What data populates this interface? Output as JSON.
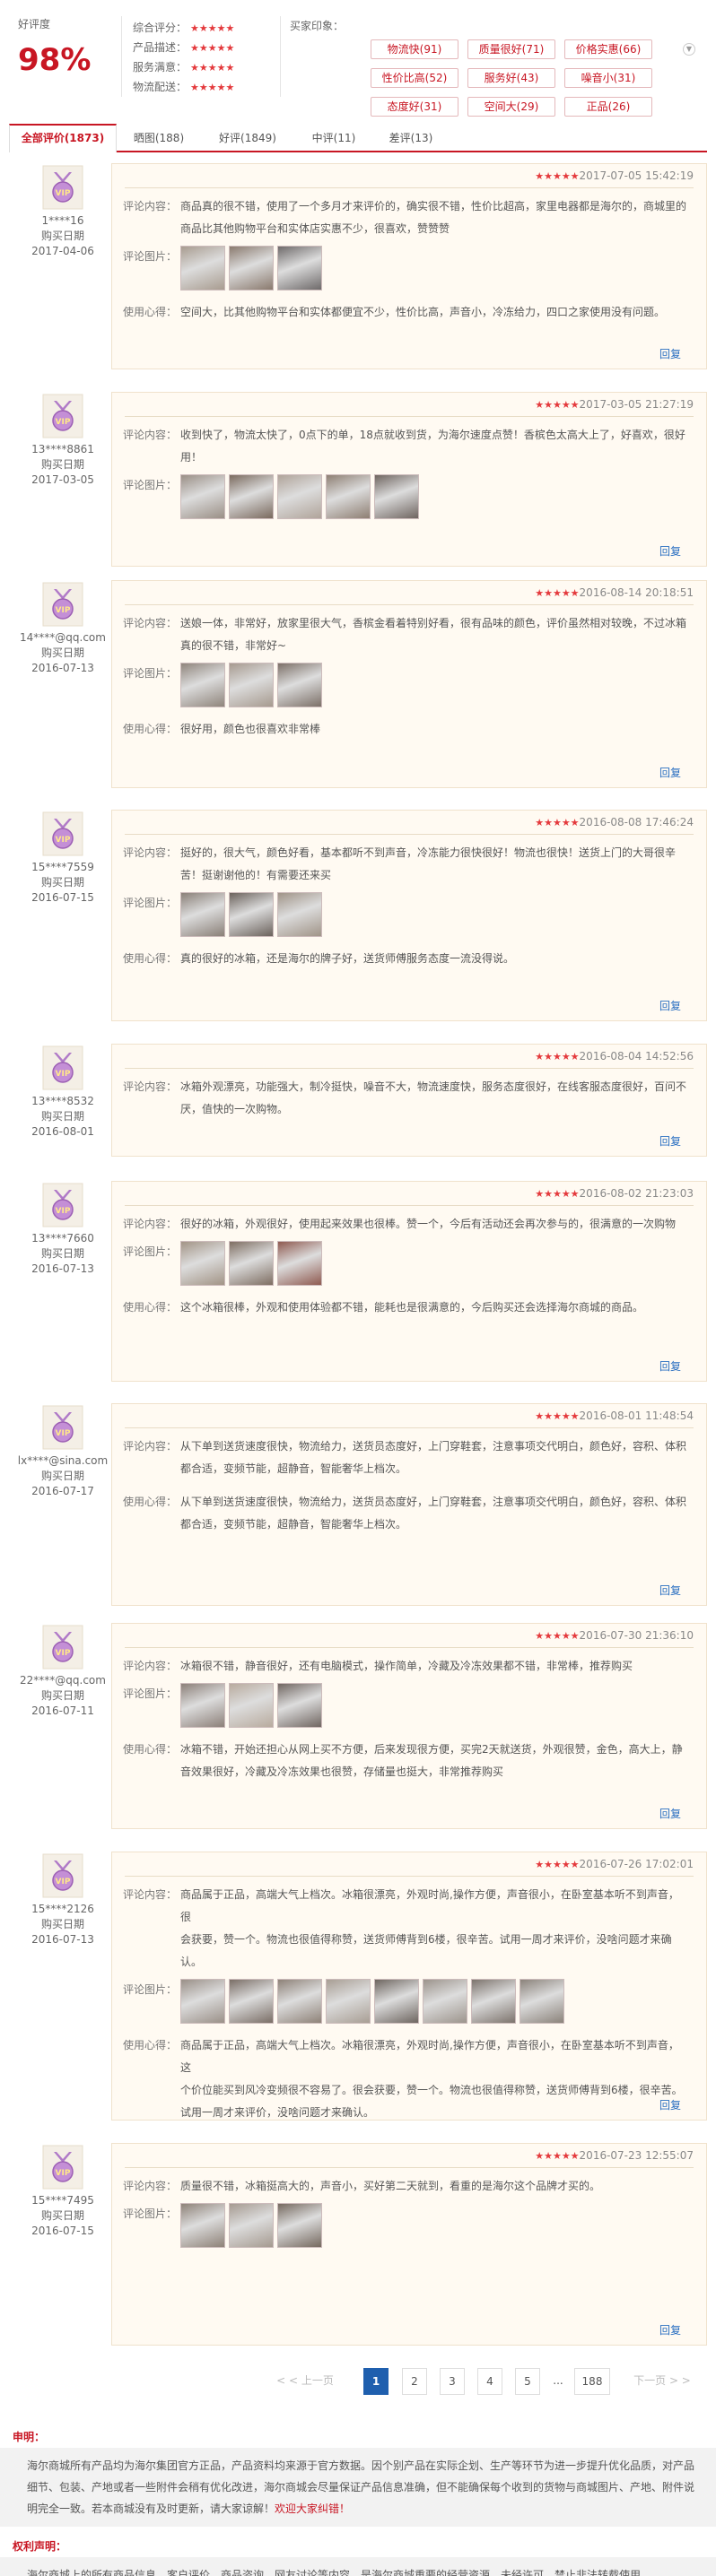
{
  "summary": {
    "good_rate_label": "好评度",
    "good_rate_value": "98%",
    "scores": [
      {
        "label": "综合评分：",
        "stars": "★★★★★",
        "rating": 5
      },
      {
        "label": "产品描述：",
        "stars": "★★★★★",
        "rating": 5
      },
      {
        "label": "服务满意：",
        "stars": "★★★★★",
        "rating": 5
      },
      {
        "label": "物流配送：",
        "stars": "★★★★★",
        "rating": 5
      }
    ],
    "impressions_label": "买家印象：",
    "tags": [
      "物流快(91)",
      "质量很好(71)",
      "价格实惠(66)",
      "性价比高(52)",
      "服务好(43)",
      "噪音小(31)",
      "态度好(31)",
      "空间大(29)",
      "正品(26)"
    ]
  },
  "tabs": [
    "全部评价(1873)",
    "晒图(188)",
    "好评(1849)",
    "中评(11)",
    "差评(13)"
  ],
  "labels": {
    "content": "评论内容：",
    "images": "评论图片：",
    "experience": "使用心得：",
    "purchase_date": "购买日期",
    "reply": "回复",
    "vip": "VIP"
  },
  "reviews": [
    {
      "user": "1****16",
      "purchase_date": "2017-04-06",
      "stars": "★★★★★",
      "rating": 5,
      "time": "2017-07-05 15:42:19",
      "content": [
        "商品真的很不错，使用了一个多月才来评价的，确实很不错，性价比超高，家里电器都是海尔的，商城里的",
        "商品比其他购物平台和实体店实惠不少，很喜欢，赞赞赞"
      ],
      "image_colors": [
        "#a89c90",
        "#8a7a6e",
        "#6e6a6a"
      ],
      "experience": [
        "空间大，比其他购物平台和实体都便宜不少，性价比高，声音小，冷冻给力，四口之家使用没有问题。"
      ]
    },
    {
      "user": "13****8861",
      "purchase_date": "2017-03-05",
      "stars": "★★★★★",
      "rating": 5,
      "time": "2017-03-05 21:27:19",
      "content": [
        "收到快了，物流太快了，0点下的单，18点就收到货，为海尔速度点赞！香槟色太高大上了，好喜欢，很好",
        "用！"
      ],
      "image_colors": [
        "#9a8f86",
        "#7a6a5e",
        "#b0a49a",
        "#8e7f73",
        "#6f6560"
      ],
      "experience": []
    },
    {
      "user": "14****@qq.com",
      "purchase_date": "2016-07-13",
      "stars": "★★★★★",
      "rating": 5,
      "time": "2016-08-14 20:18:51",
      "content": [
        "送娘一体，非常好，放家里很大气，香槟金看着特别好看，很有品味的颜色，评价虽然相对较晚，不过冰箱",
        "真的很不错，非常好~"
      ],
      "image_colors": [
        "#8f857c",
        "#a69a8f",
        "#7c7068"
      ],
      "experience": [
        "很好用，颜色也很喜欢非常棒"
      ]
    },
    {
      "user": "15****7559",
      "purchase_date": "2016-07-15",
      "stars": "★★★★★",
      "rating": 5,
      "time": "2016-08-08 17:46:24",
      "content": [
        "挺好的，很大气，颜色好看，基本都听不到声音，冷冻能力很快很好！物流也很快！送货上门的大哥很辛",
        "苦！挺谢谢他的！有需要还来买"
      ],
      "image_colors": [
        "#8a8078",
        "#6b625c",
        "#a09488"
      ],
      "experience": [
        "真的很好的冰箱，还是海尔的牌子好，送货师傅服务态度一流没得说。"
      ]
    },
    {
      "user": "13****8532",
      "purchase_date": "2016-08-01",
      "stars": "★★★★★",
      "rating": 5,
      "time": "2016-08-04 14:52:56",
      "content": [
        "冰箱外观漂亮，功能强大，制冷挺快，噪音不大，物流速度快，服务态度很好，在线客服态度很好，百问不",
        "厌，值快的一次购物。"
      ],
      "image_colors": [],
      "experience": []
    },
    {
      "user": "13****7660",
      "purchase_date": "2016-07-13",
      "stars": "★★★★★",
      "rating": 5,
      "time": "2016-08-02 21:23:03",
      "content": [
        "很好的冰箱，外观很好，使用起来效果也很棒。赞一个，今后有活动还会再次参与的，很满意的一次购物"
      ],
      "image_colors": [
        "#a29486",
        "#7e6e62",
        "#8f5a50"
      ],
      "experience": [
        "这个冰箱很棒，外观和使用体验都不错，能耗也是很满意的，今后购买还会选择海尔商城的商品。"
      ]
    },
    {
      "user": "lx****@sina.com",
      "purchase_date": "2016-07-17",
      "stars": "★★★★★",
      "rating": 5,
      "time": "2016-08-01 11:48:54",
      "content": [
        "从下单到送货速度很快，物流给力，送货员态度好，上门穿鞋套，注意事项交代明白，颜色好，容积、体积",
        "都合适，变频节能，超静音，智能奢华上档次。"
      ],
      "image_colors": [],
      "experience": [
        "从下单到送货速度很快，物流给力，送货员态度好，上门穿鞋套，注意事项交代明白，颜色好，容积、体积",
        "都合适，变频节能，超静音，智能奢华上档次。"
      ]
    },
    {
      "user": "22****@qq.com",
      "purchase_date": "2016-07-11",
      "stars": "★★★★★",
      "rating": 5,
      "time": "2016-07-30 21:36:10",
      "content": [
        "冰箱很不错，静音很好，还有电脑模式，操作简单，冷藏及冷冻效果都不错，非常棒，推荐购买"
      ],
      "image_colors": [
        "#8c8079",
        "#b8ab9e",
        "#706661"
      ],
      "experience": [
        "冰箱不错，开始还担心从网上买不方便，后来发现很方便，买完2天就送货，外观很赞，金色，高大上，静",
        "音效果很好，冷藏及冷冻效果也很赞，存储量也挺大，非常推荐购买"
      ]
    },
    {
      "user": "15****2126",
      "purchase_date": "2016-07-13",
      "stars": "★★★★★",
      "rating": 5,
      "time": "2016-07-26 17:02:01",
      "content": [
        "商品属于正品，高端大气上档次。冰箱很漂亮，外观时尚,操作方便，声音很小，在卧室基本听不到声音，很",
        "会获要，赞一个。物流也很值得称赞，送货师傅背到6楼，很辛苦。试用一周才来评价，没啥问题才来确",
        "认。"
      ],
      "image_colors": [
        "#9a9088",
        "#7a6e66",
        "#8e8278",
        "#a89e94",
        "#6e6660",
        "#9c948c",
        "#7d746d",
        "#8b837b"
      ],
      "experience": [
        "商品属于正品，高端大气上档次。冰箱很漂亮，外观时尚,操作方便，声音很小，在卧室基本听不到声音，这",
        "个价位能买到风冷变频很不容易了。很会获要，赞一个。物流也很值得称赞，送货师傅背到6楼，很辛苦。",
        "试用一周才来评价，没啥问题才来确认。"
      ]
    },
    {
      "user": "15****7495",
      "purchase_date": "2016-07-15",
      "stars": "★★★★★",
      "rating": 5,
      "time": "2016-07-23 12:55:07",
      "content": [
        "质量很不错，冰箱挺高大的，声音小，买好第二天就到，看重的是海尔这个品牌才买的。"
      ],
      "image_colors": [
        "#8e8278",
        "#a59a90",
        "#75695f"
      ],
      "experience": []
    }
  ],
  "pagination": {
    "prev": "< < 上一页",
    "pages": [
      "1",
      "2",
      "3",
      "4",
      "5"
    ],
    "ellipsis": "...",
    "last": "188",
    "next": "下一页 > >"
  },
  "notices": [
    {
      "title": "申明：",
      "text": "海尔商城所有产品均为海尔集团官方正品，产品资料均来源于官方数据。因个别产品在实际企划、生产等环节为进一步提升优化品质，对产品细节、包装、产地或者一些附件会稍有优化改进，海尔商城会尽量保证产品信息准确，但不能确保每个收到的货物与商城图片、产地、附件说明完全一致。若本商城没有及时更新，请大家谅解！",
      "highlight": "欢迎大家纠错！"
    },
    {
      "title": "权利声明：",
      "text": "海尔商城上的所有商品信息、客户评价、商品咨询、网友讨论等内容，是海尔商城重要的经营资源，未经许可，禁止非法转载使用。",
      "highlight": ""
    }
  ]
}
